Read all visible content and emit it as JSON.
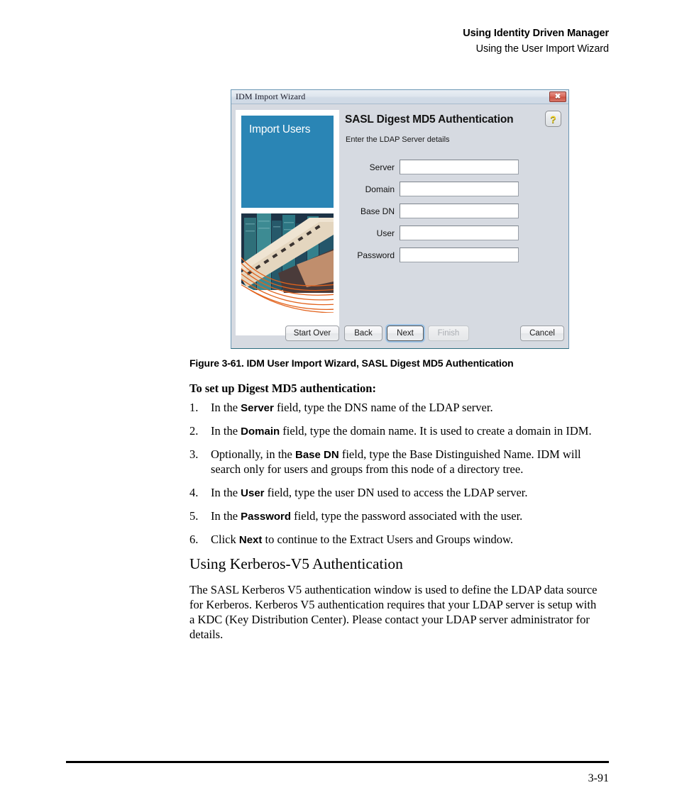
{
  "header": {
    "line1": "Using Identity Driven Manager",
    "line2": "Using the User Import Wizard"
  },
  "wizard": {
    "window_title": "IDM Import Wizard",
    "close_glyph": "✖",
    "side_panel": {
      "banner_label": "Import Users",
      "banner_color": "#2a85b5",
      "photo_alt": "city-skyline-overpass-photo"
    },
    "heading": "SASL Digest MD5 Authentication",
    "help_glyph": "?",
    "subtext": "Enter the LDAP Server details",
    "fields": [
      {
        "label": "Server",
        "value": "",
        "placeholder": ""
      },
      {
        "label": "Domain",
        "value": "",
        "placeholder": ""
      },
      {
        "label": "Base DN",
        "value": "",
        "placeholder": ""
      },
      {
        "label": "User",
        "value": "",
        "placeholder": ""
      },
      {
        "label": "Password",
        "value": "",
        "placeholder": ""
      }
    ],
    "buttons": {
      "start_over": "Start Over",
      "back": "Back",
      "next": "Next",
      "finish": "Finish",
      "cancel": "Cancel"
    }
  },
  "document": {
    "figure_caption": "Figure 3-61. IDM User Import Wizard, SASL Digest MD5 Authentication",
    "procedure_intro": "To set up Digest MD5 authentication:",
    "steps": [
      {
        "num": "1.",
        "pre": "In the ",
        "bold": "Server",
        "post": " field, type the DNS name of the LDAP server."
      },
      {
        "num": "2.",
        "pre": "In the ",
        "bold": "Domain",
        "post": " field, type the domain name. It is used to create a domain in IDM."
      },
      {
        "num": "3.",
        "pre": "Optionally, in the ",
        "bold": "Base DN",
        "post": " field, type the Base Distinguished Name. IDM will search only for users and groups from this node of a directory tree."
      },
      {
        "num": "4.",
        "pre": "In the ",
        "bold": "User",
        "post": " field, type the user DN used to access the LDAP server."
      },
      {
        "num": "5.",
        "pre": "In the ",
        "bold": "Password",
        "post": " field, type the password associated with the user."
      },
      {
        "num": "6.",
        "pre": "Click ",
        "bold": "Next",
        "post": " to continue to the Extract Users and Groups window."
      }
    ],
    "section_heading": "Using Kerberos-V5 Authentication",
    "section_body": "The SASL Kerberos V5 authentication window is used to define the LDAP data source for Kerberos. Kerberos V5 authentication requires that your LDAP server is setup with a KDC (Key Distribution Center). Please contact your LDAP server administrator for details.",
    "page_number": "3-91"
  }
}
